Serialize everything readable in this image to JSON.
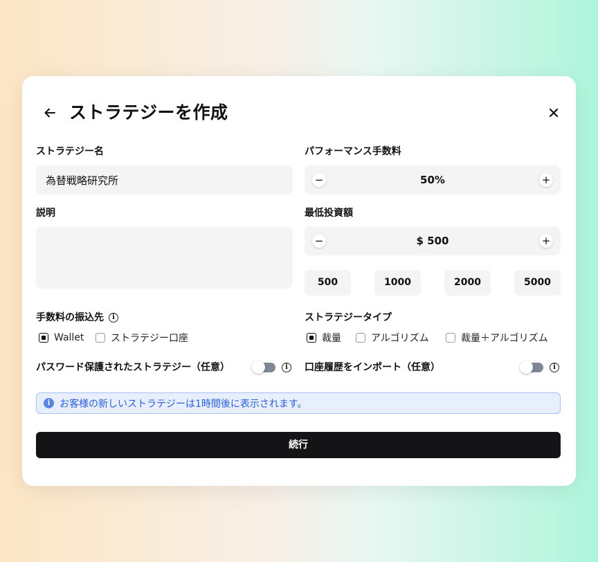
{
  "modal": {
    "title": "ストラテジーを作成",
    "back_icon": "arrow-left-icon",
    "close_icon": "close-icon"
  },
  "strategy_name": {
    "label": "ストラテジー名",
    "value": "為替戦略研究所"
  },
  "description": {
    "label": "説明",
    "value": ""
  },
  "performance_fee": {
    "label": "パフォーマンス手数料",
    "value": "50%",
    "minus": "−",
    "plus": "+"
  },
  "min_investment": {
    "label": "最低投資額",
    "value": "$ 500",
    "minus": "−",
    "plus": "+",
    "presets": [
      "500",
      "1000",
      "2000",
      "5000"
    ]
  },
  "fee_destination": {
    "label": "手数料の振込先",
    "options": [
      {
        "label": "Wallet",
        "checked": true
      },
      {
        "label": "ストラテジー口座",
        "checked": false
      }
    ]
  },
  "strategy_type": {
    "label": "ストラテジータイプ",
    "options": [
      {
        "label": "裁量",
        "checked": true
      },
      {
        "label": "アルゴリズム",
        "checked": false
      },
      {
        "label": "裁量＋アルゴリズム",
        "checked": false
      }
    ]
  },
  "password_protect": {
    "label": "パスワード保護されたストラテジー（任意）",
    "enabled": false
  },
  "import_history": {
    "label": "口座履歴をインポート（任意）",
    "enabled": false
  },
  "notice": {
    "icon_text": "i",
    "text": "お客様の新しいストラテジーは1時間後に表示されます。"
  },
  "info_icon_text": "i",
  "continue_label": "続行",
  "colors": {
    "primary_button": "#141416",
    "notice_text": "#2b5fd8",
    "notice_bg": "#e7eefc",
    "toggle_off": "#7d8798"
  }
}
